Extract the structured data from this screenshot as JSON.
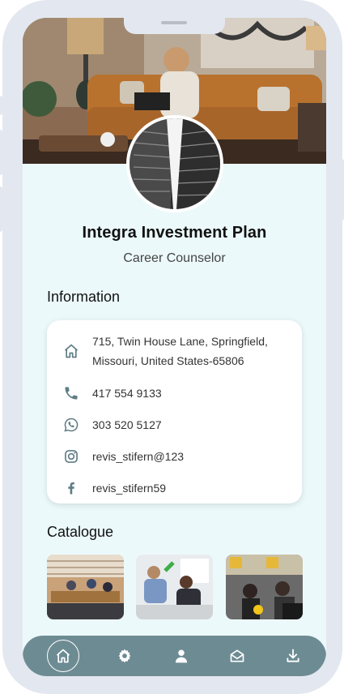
{
  "profile": {
    "name": "Integra Investment Plan",
    "role": "Career Counselor"
  },
  "information": {
    "title": "Information",
    "address_line1": "715, Twin House Lane, Springfield,",
    "address_line2": "Missouri, United States-65806",
    "phone": "417 554 9133",
    "whatsapp": "303 520 5127",
    "instagram": "revis_stifern@123",
    "facebook": "revis_stifern59"
  },
  "catalogue": {
    "title": "Catalogue",
    "items": [
      "office-photo-1",
      "office-photo-2",
      "office-photo-3"
    ]
  },
  "nav": {
    "items": [
      "home-icon",
      "gear-icon",
      "user-icon",
      "mail-open-icon",
      "download-icon"
    ],
    "active": "home-icon"
  },
  "colors": {
    "screen_bg": "#ecf9fb",
    "nav_bg": "#6d8b93",
    "icon": "#5e7d86",
    "frame": "#e3e7ef"
  }
}
